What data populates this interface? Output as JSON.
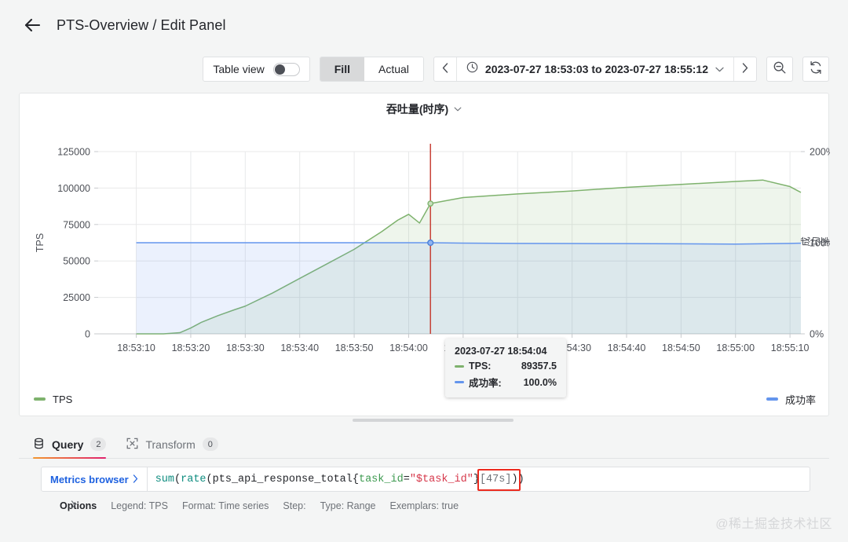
{
  "header": {
    "back_icon": "arrow-left-icon",
    "breadcrumb": "PTS-Overview / Edit Panel"
  },
  "toolbar": {
    "table_view_label": "Table view",
    "table_view_on": false,
    "fill_label": "Fill",
    "actual_label": "Actual",
    "active_segment": "Fill",
    "time_prev_icon": "chevron-left-icon",
    "time_next_icon": "chevron-right-icon",
    "clock_icon": "clock-icon",
    "time_range": "2023-07-27 18:53:03 to 2023-07-27 18:55:12",
    "time_dropdown_icon": "chevron-down-icon",
    "zoom_out_icon": "zoom-out-icon",
    "refresh_icon": "refresh-icon"
  },
  "panel": {
    "title": "吞吐量(时序)",
    "title_menu_icon": "chevron-down-icon",
    "legend": [
      {
        "label": "TPS",
        "color": "#7eb26d"
      },
      {
        "label": "成功率",
        "color": "#6495ed"
      }
    ]
  },
  "tooltip": {
    "time": "2023-07-27 18:54:04",
    "rows": [
      {
        "name": "TPS:",
        "value": "89357.5",
        "color": "#7eb26d"
      },
      {
        "name": "成功率:",
        "value": "100.0%",
        "color": "#6495ed"
      }
    ]
  },
  "tabs": [
    {
      "label": "Query",
      "badge": "2",
      "icon": "database-icon",
      "active": true
    },
    {
      "label": "Transform",
      "badge": "0",
      "icon": "transform-icon",
      "active": false
    }
  ],
  "query": {
    "metrics_browser_label": "Metrics browser",
    "metrics_browser_icon": "chevron-right-icon",
    "expression": "sum(rate(pts_api_response_total{task_id=\"$task_id\"}[47s]))",
    "highlighted_fragment": "[47s])",
    "tokens": [
      {
        "t": "sum",
        "c": "fn"
      },
      {
        "t": "(",
        "c": "punct"
      },
      {
        "t": "rate",
        "c": "fn"
      },
      {
        "t": "(",
        "c": "punct"
      },
      {
        "t": "pts_api_response_total",
        "c": "metric"
      },
      {
        "t": "{",
        "c": "punct"
      },
      {
        "t": "task_id",
        "c": "label"
      },
      {
        "t": "=",
        "c": "punct"
      },
      {
        "t": "\"$task_id\"",
        "c": "str"
      },
      {
        "t": "}",
        "c": "punct"
      },
      {
        "t": "[47s]",
        "c": "dur"
      },
      {
        "t": ")",
        "c": "punct"
      },
      {
        "t": ")",
        "c": "punct"
      }
    ],
    "options": {
      "caret_icon": "chevron-right-icon",
      "title": "Options",
      "items": [
        "Legend: TPS",
        "Format: Time series",
        "Step:",
        "Type: Range",
        "Exemplars: true"
      ]
    }
  },
  "watermark": "@稀土掘金技术社区",
  "chart_data": {
    "type": "line",
    "title": "吞吐量(时序)",
    "xlabel": "",
    "ylabel": "TPS",
    "y2label": "成功率",
    "grid": true,
    "legend_position": "bottom",
    "xlim": [
      "18:53:03",
      "18:55:12"
    ],
    "xticks": [
      "18:53:10",
      "18:53:20",
      "18:53:30",
      "18:53:40",
      "18:53:50",
      "18:54:00",
      "18:54:10",
      "18:54:20",
      "18:54:30",
      "18:54:40",
      "18:54:50",
      "18:55:00",
      "18:55:10"
    ],
    "ylim": [
      0,
      125000
    ],
    "yticks": [
      0,
      25000,
      50000,
      75000,
      100000,
      125000
    ],
    "y2lim": [
      0,
      200
    ],
    "y2ticks": [
      "0%",
      "100%",
      "200%"
    ],
    "cursor_time": "18:54:04",
    "series": [
      {
        "name": "TPS",
        "color": "#7eb26d",
        "axis": "left",
        "fill": true,
        "x": [
          "18:53:10",
          "18:53:15",
          "18:53:18",
          "18:53:20",
          "18:53:22",
          "18:53:25",
          "18:53:28",
          "18:53:30",
          "18:53:35",
          "18:53:40",
          "18:53:45",
          "18:53:50",
          "18:53:55",
          "18:53:58",
          "18:54:00",
          "18:54:02",
          "18:54:04",
          "18:54:10",
          "18:54:20",
          "18:54:30",
          "18:54:40",
          "18:54:50",
          "18:55:00",
          "18:55:05",
          "18:55:10",
          "18:55:12"
        ],
        "values": [
          0,
          0,
          800,
          4000,
          8000,
          12500,
          16500,
          19000,
          28000,
          38000,
          48000,
          58000,
          70000,
          78000,
          82000,
          76000,
          89357.5,
          93500,
          96000,
          98000,
          100500,
          102500,
          104500,
          105500,
          101000,
          97000
        ]
      },
      {
        "name": "成功率",
        "color": "#6495ed",
        "axis": "right",
        "fill": true,
        "x": [
          "18:53:10",
          "18:53:20",
          "18:53:30",
          "18:53:40",
          "18:53:50",
          "18:54:00",
          "18:54:04",
          "18:54:10",
          "18:54:20",
          "18:54:30",
          "18:54:40",
          "18:54:50",
          "18:55:00",
          "18:55:10",
          "18:55:12"
        ],
        "values": [
          100,
          100,
          100,
          100,
          100,
          100,
          100,
          99.6,
          99.2,
          99.1,
          99.0,
          98.8,
          98.5,
          99.2,
          99.5
        ]
      }
    ]
  }
}
